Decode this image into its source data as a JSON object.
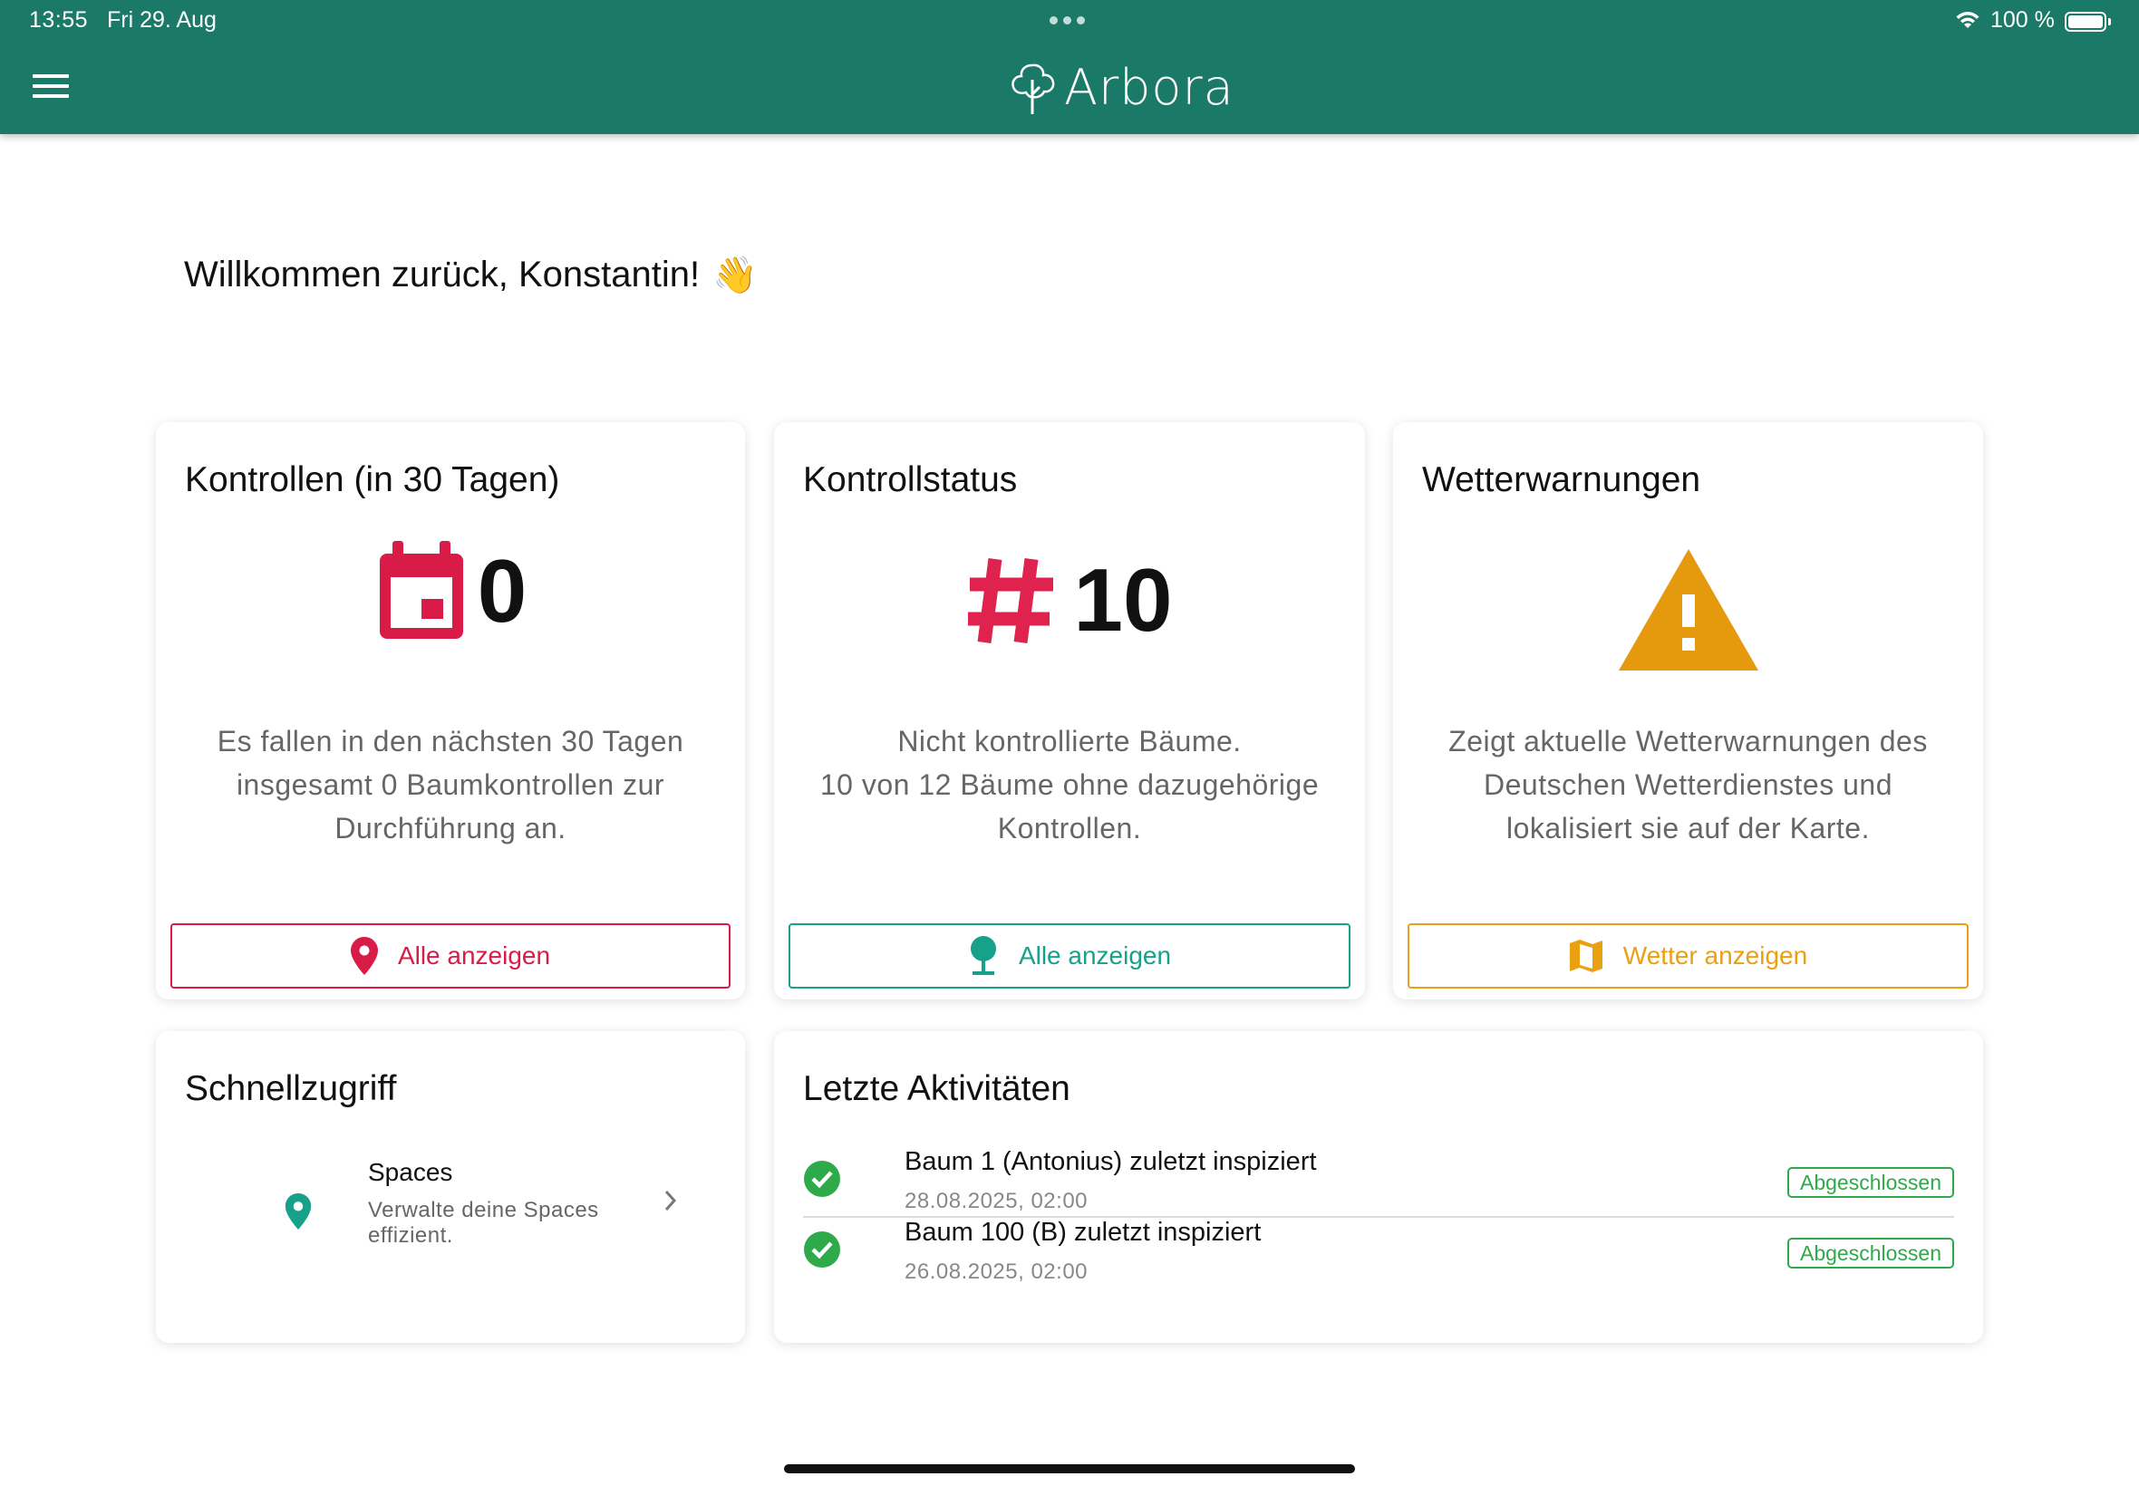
{
  "status_bar": {
    "time": "13:55",
    "date": "Fri 29. Aug",
    "battery": "100 %"
  },
  "header": {
    "app_name": "Arbora",
    "color": "#1b7a67"
  },
  "welcome": {
    "text": "Willkommen zurück, Konstantin!",
    "emoji": "👋"
  },
  "cards": {
    "kontrollen": {
      "title": "Kontrollen (in 30 Tagen)",
      "value": "0",
      "icon": "calendar-icon",
      "description": [
        "Es fallen in den nächsten 30 Tagen",
        "insgesamt 0 Baumkontrollen zur",
        "Durchführung an."
      ],
      "button": "Alle anzeigen",
      "accent": "#d81b47"
    },
    "kontrollstatus": {
      "title": "Kontrollstatus",
      "value": "10",
      "icon": "hash-icon",
      "description": [
        "Nicht kontrollierte Bäume.",
        "10 von 12 Bäume ohne dazugehörige",
        "Kontrollen."
      ],
      "button": "Alle anzeigen",
      "accent": "#17a08a"
    },
    "wetter": {
      "title": "Wetterwarnungen",
      "icon": "warning-icon",
      "description": [
        "Zeigt aktuelle Wetterwarnungen des",
        "Deutschen Wetterdienstes und",
        "lokalisiert sie auf der Karte."
      ],
      "button": "Wetter anzeigen",
      "accent": "#eaa012"
    }
  },
  "quick_access": {
    "title": "Schnellzugriff",
    "items": [
      {
        "title": "Spaces",
        "subtitle": "Verwalte deine Spaces effizient.",
        "icon": "map-pin-icon"
      }
    ]
  },
  "activities": {
    "title": "Letzte Aktivitäten",
    "items": [
      {
        "title": "Baum 1 (Antonius) zuletzt inspiziert",
        "date": "28.08.2025, 02:00",
        "status": "Abgeschlossen"
      },
      {
        "title": "Baum 100 (B) zuletzt inspiziert",
        "date": "26.08.2025, 02:00",
        "status": "Abgeschlossen"
      }
    ]
  }
}
